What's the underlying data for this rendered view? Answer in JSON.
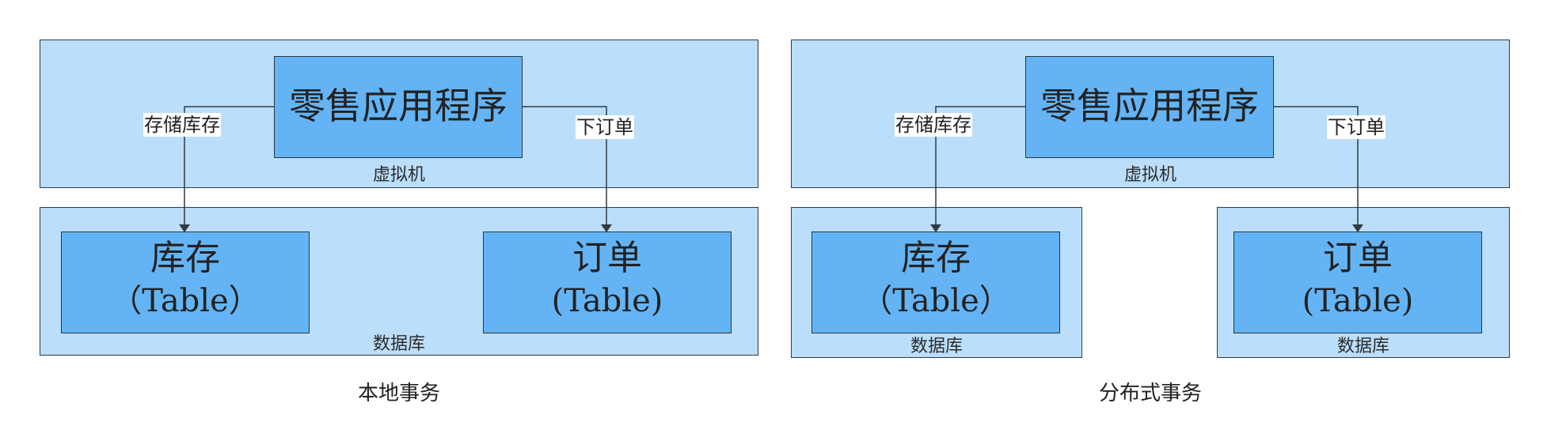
{
  "left_diagram": {
    "app_title": "零售应用程序",
    "vm_label": "虚拟机",
    "edge_inventory_label": "存储库存",
    "edge_order_label": "下订单",
    "inventory_table": {
      "name": "库存",
      "type": "（Table）"
    },
    "order_table": {
      "name": "订单",
      "type": "(Table)"
    },
    "db_label": "数据库",
    "caption": "本地事务"
  },
  "right_diagram": {
    "app_title": "零售应用程序",
    "vm_label": "虚拟机",
    "edge_inventory_label": "存储库存",
    "edge_order_label": "下订单",
    "inventory_table": {
      "name": "库存",
      "type": "（Table）"
    },
    "order_table": {
      "name": "订单",
      "type": "(Table)"
    },
    "inventory_db_label": "数据库",
    "order_db_label": "数据库",
    "caption": "分布式事务"
  },
  "colors": {
    "container_fill": "#bbdefa",
    "inner_fill": "#64b4f5",
    "stroke": "#2f3a44"
  }
}
